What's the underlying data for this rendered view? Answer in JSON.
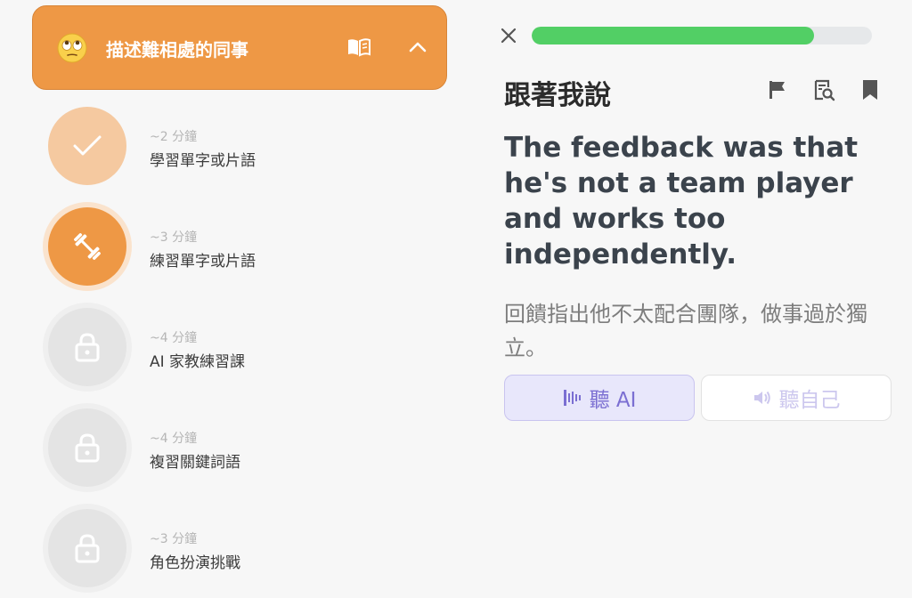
{
  "lesson": {
    "title": "描述難相處的同事",
    "emoji": "eye-roll-face",
    "header_color": "#ee9845"
  },
  "steps": [
    {
      "duration": "~2 分鐘",
      "label": "學習單字或片語",
      "state": "completed",
      "icon": "checkmark-icon"
    },
    {
      "duration": "~3 分鐘",
      "label": "練習單字或片語",
      "state": "active",
      "icon": "dumbbell-icon"
    },
    {
      "duration": "~4 分鐘",
      "label": "AI 家教練習課",
      "state": "locked",
      "icon": "lock-icon"
    },
    {
      "duration": "~4 分鐘",
      "label": "複習關鍵詞語",
      "state": "locked",
      "icon": "lock-icon"
    },
    {
      "duration": "~3 分鐘",
      "label": "角色扮演挑戰",
      "state": "locked",
      "icon": "lock-icon"
    }
  ],
  "exercise": {
    "progress": 0.83,
    "title": "跟著我說",
    "sentence": "The feedback was that he's not a team player and works too independently.",
    "translation": "回饋指出他不太配合團隊，做事過於獨立。",
    "listen_ai_label": "聽 AI",
    "listen_self_label": "聽自己",
    "toolbar_icons": [
      "flag-icon",
      "search-document-icon",
      "bookmark-icon"
    ]
  },
  "colors": {
    "orange": "#ee9845",
    "orange_light": "#f5c9a0",
    "green": "#52cf65",
    "purple": "#7b6fd2",
    "locked": "#e4e4e4"
  }
}
